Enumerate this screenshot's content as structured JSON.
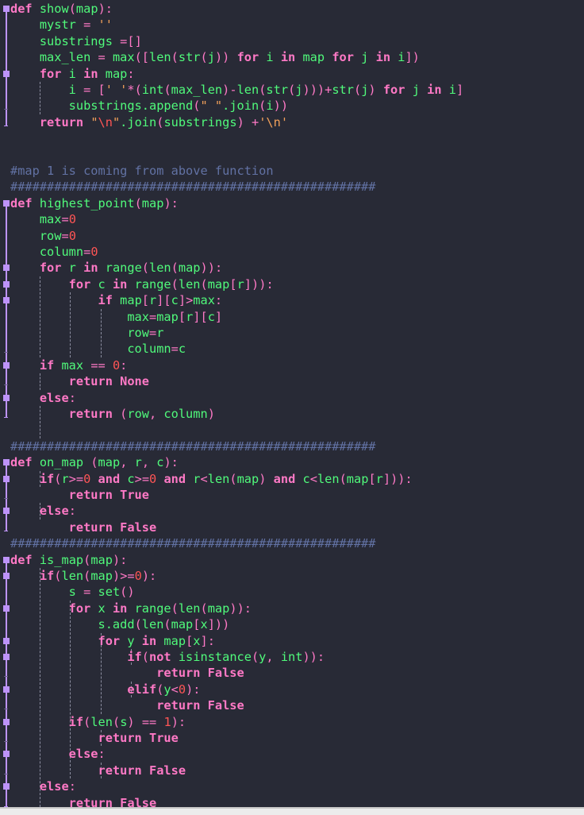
{
  "editor": {
    "theme_colors": {
      "background": "#282a36",
      "keyword": "#ff79c6",
      "identifier": "#50fa7b",
      "number": "#ff5555",
      "string": "#f1a05a",
      "comment": "#6272a4",
      "fold_marker": "#bd93f9"
    },
    "lines": [
      [
        [
          "kb",
          "def"
        ],
        [
          "g",
          " show"
        ],
        [
          "p",
          "("
        ],
        [
          "g",
          "map"
        ],
        [
          "p",
          "):"
        ]
      ],
      [
        [
          "g",
          "    mystr "
        ],
        [
          "p",
          "="
        ],
        [
          "s",
          " ''"
        ]
      ],
      [
        [
          "g",
          "    substrings "
        ],
        [
          "p",
          "=[]"
        ]
      ],
      [
        [
          "g",
          "    max_len "
        ],
        [
          "p",
          "="
        ],
        [
          "g",
          " max"
        ],
        [
          "p",
          "([",
          ""
        ],
        [
          "g",
          "len"
        ],
        [
          "p",
          "("
        ],
        [
          "g",
          "str"
        ],
        [
          "p",
          "("
        ],
        [
          "g",
          "j"
        ],
        [
          "p",
          "))"
        ],
        [
          "kb",
          " for"
        ],
        [
          "g",
          " i "
        ],
        [
          "kb",
          "in"
        ],
        [
          "g",
          " map "
        ],
        [
          "kb",
          "for"
        ],
        [
          "g",
          " j "
        ],
        [
          "kb",
          "in"
        ],
        [
          "g",
          " i"
        ],
        [
          "p",
          "])"
        ]
      ],
      [
        [
          "kb",
          "    for"
        ],
        [
          "g",
          " i "
        ],
        [
          "kb",
          "in"
        ],
        [
          "g",
          " map"
        ],
        [
          "p",
          ":"
        ]
      ],
      [
        [
          "g",
          "        i "
        ],
        [
          "p",
          "="
        ],
        [
          "p",
          " ["
        ],
        [
          "s",
          "' '"
        ],
        [
          "p",
          "*("
        ],
        [
          "g",
          "int"
        ],
        [
          "p",
          "("
        ],
        [
          "g",
          "max_len"
        ],
        [
          "p",
          ")-"
        ],
        [
          "g",
          "len"
        ],
        [
          "p",
          "("
        ],
        [
          "g",
          "str"
        ],
        [
          "p",
          "("
        ],
        [
          "g",
          "j"
        ],
        [
          "p",
          ")))+"
        ],
        [
          "g",
          "str"
        ],
        [
          "p",
          "("
        ],
        [
          "g",
          "j"
        ],
        [
          "p",
          ")"
        ],
        [
          "kb",
          " for"
        ],
        [
          "g",
          " j "
        ],
        [
          "kb",
          "in"
        ],
        [
          "g",
          " i"
        ],
        [
          "p",
          "]"
        ]
      ],
      [
        [
          "g",
          "        substrings.append"
        ],
        [
          "p",
          "("
        ],
        [
          "s",
          "\" \""
        ],
        [
          "g",
          ".join"
        ],
        [
          "p",
          "("
        ],
        [
          "g",
          "i"
        ],
        [
          "p",
          "))"
        ]
      ],
      [
        [
          "kb",
          "    return"
        ],
        [
          "s",
          " \""
        ],
        [
          "esc",
          "\\n"
        ],
        [
          "s",
          "\""
        ],
        [
          "g",
          ".join"
        ],
        [
          "p",
          "("
        ],
        [
          "g",
          "substrings"
        ],
        [
          "p",
          ")"
        ],
        [
          "p",
          " +"
        ],
        [
          "s",
          "'\\n'"
        ]
      ],
      [],
      [],
      [
        [
          "c",
          "#map 1 is coming from above function"
        ]
      ],
      [
        [
          "c",
          "##################################################"
        ]
      ],
      [
        [
          "kb",
          "def"
        ],
        [
          "g",
          " highest_point"
        ],
        [
          "p",
          "("
        ],
        [
          "g",
          "map"
        ],
        [
          "p",
          "):"
        ]
      ],
      [
        [
          "g",
          "    max"
        ],
        [
          "p",
          "="
        ],
        [
          "n",
          "0"
        ]
      ],
      [
        [
          "g",
          "    row"
        ],
        [
          "p",
          "="
        ],
        [
          "n",
          "0"
        ]
      ],
      [
        [
          "g",
          "    column"
        ],
        [
          "p",
          "="
        ],
        [
          "n",
          "0"
        ]
      ],
      [
        [
          "kb",
          "    for"
        ],
        [
          "g",
          " r "
        ],
        [
          "kb",
          "in"
        ],
        [
          "g",
          " range"
        ],
        [
          "p",
          "("
        ],
        [
          "g",
          "len"
        ],
        [
          "p",
          "("
        ],
        [
          "g",
          "map"
        ],
        [
          "p",
          "))"
        ],
        [
          "p",
          ":"
        ]
      ],
      [
        [
          "kb",
          "        for"
        ],
        [
          "g",
          " c "
        ],
        [
          "kb",
          "in"
        ],
        [
          "g",
          " range"
        ],
        [
          "p",
          "("
        ],
        [
          "g",
          "len"
        ],
        [
          "p",
          "("
        ],
        [
          "g",
          "map"
        ],
        [
          "p",
          "["
        ],
        [
          "g",
          "r"
        ],
        [
          "p",
          "]))"
        ],
        [
          "p",
          ":"
        ]
      ],
      [
        [
          "kb",
          "            if"
        ],
        [
          "g",
          " map"
        ],
        [
          "p",
          "["
        ],
        [
          "g",
          "r"
        ],
        [
          "p",
          "]["
        ],
        [
          "g",
          "c"
        ],
        [
          "p",
          "]>"
        ],
        [
          "g",
          "max"
        ],
        [
          "p",
          ":"
        ]
      ],
      [
        [
          "g",
          "                max"
        ],
        [
          "p",
          "="
        ],
        [
          "g",
          "map"
        ],
        [
          "p",
          "["
        ],
        [
          "g",
          "r"
        ],
        [
          "p",
          "]["
        ],
        [
          "g",
          "c"
        ],
        [
          "p",
          "]"
        ]
      ],
      [
        [
          "g",
          "                row"
        ],
        [
          "p",
          "="
        ],
        [
          "g",
          "r"
        ]
      ],
      [
        [
          "g",
          "                column"
        ],
        [
          "p",
          "="
        ],
        [
          "g",
          "c"
        ]
      ],
      [
        [
          "kb",
          "    if"
        ],
        [
          "g",
          " max "
        ],
        [
          "p",
          "=="
        ],
        [
          "n",
          " 0"
        ],
        [
          "p",
          ":"
        ]
      ],
      [
        [
          "kb",
          "        return None"
        ]
      ],
      [
        [
          "kb",
          "    else"
        ],
        [
          "p",
          ":"
        ]
      ],
      [
        [
          "kb",
          "        return"
        ],
        [
          "p",
          " ("
        ],
        [
          "g",
          "row"
        ],
        [
          "p",
          ","
        ],
        [
          "g",
          " column"
        ],
        [
          "p",
          ")"
        ]
      ],
      [],
      [
        [
          "c",
          "##################################################"
        ]
      ],
      [
        [
          "kb",
          "def"
        ],
        [
          "g",
          " on_map "
        ],
        [
          "p",
          "("
        ],
        [
          "g",
          "map"
        ],
        [
          "p",
          ","
        ],
        [
          "g",
          " r"
        ],
        [
          "p",
          ","
        ],
        [
          "g",
          " c"
        ],
        [
          "p",
          "):"
        ]
      ],
      [
        [
          "kb",
          "    if"
        ],
        [
          "p",
          "("
        ],
        [
          "g",
          "r"
        ],
        [
          "p",
          ">="
        ],
        [
          "n",
          "0"
        ],
        [
          "kb",
          " and"
        ],
        [
          "g",
          " c"
        ],
        [
          "p",
          ">="
        ],
        [
          "n",
          "0"
        ],
        [
          "kb",
          " and"
        ],
        [
          "g",
          " r"
        ],
        [
          "p",
          "<"
        ],
        [
          "g",
          "len"
        ],
        [
          "p",
          "("
        ],
        [
          "g",
          "map"
        ],
        [
          "p",
          ")"
        ],
        [
          "kb",
          " and"
        ],
        [
          "g",
          " c"
        ],
        [
          "p",
          "<"
        ],
        [
          "g",
          "len"
        ],
        [
          "p",
          "("
        ],
        [
          "g",
          "map"
        ],
        [
          "p",
          "["
        ],
        [
          "g",
          "r"
        ],
        [
          "p",
          "])):"
        ]
      ],
      [
        [
          "kb",
          "        return True"
        ]
      ],
      [
        [
          "kb",
          "    else"
        ],
        [
          "p",
          ":"
        ]
      ],
      [
        [
          "kb",
          "        return False"
        ]
      ],
      [
        [
          "c",
          "##################################################"
        ]
      ],
      [
        [
          "kb",
          "def"
        ],
        [
          "g",
          " is_map"
        ],
        [
          "p",
          "("
        ],
        [
          "g",
          "map"
        ],
        [
          "p",
          "):"
        ]
      ],
      [
        [
          "kb",
          "    if"
        ],
        [
          "p",
          "("
        ],
        [
          "g",
          "len"
        ],
        [
          "p",
          "("
        ],
        [
          "g",
          "map"
        ],
        [
          "p",
          ")>="
        ],
        [
          "n",
          "0"
        ],
        [
          "p",
          "):"
        ]
      ],
      [
        [
          "g",
          "        s "
        ],
        [
          "p",
          "="
        ],
        [
          "g",
          " set"
        ],
        [
          "p",
          "()"
        ]
      ],
      [
        [
          "kb",
          "        for"
        ],
        [
          "g",
          " x "
        ],
        [
          "kb",
          "in"
        ],
        [
          "g",
          " range"
        ],
        [
          "p",
          "("
        ],
        [
          "g",
          "len"
        ],
        [
          "p",
          "("
        ],
        [
          "g",
          "map"
        ],
        [
          "p",
          "))"
        ],
        [
          "p",
          ":"
        ]
      ],
      [
        [
          "g",
          "            s.add"
        ],
        [
          "p",
          "("
        ],
        [
          "g",
          "len"
        ],
        [
          "p",
          "("
        ],
        [
          "g",
          "map"
        ],
        [
          "p",
          "["
        ],
        [
          "g",
          "x"
        ],
        [
          "p",
          "]))"
        ]
      ],
      [
        [
          "kb",
          "            for"
        ],
        [
          "g",
          " y "
        ],
        [
          "kb",
          "in"
        ],
        [
          "g",
          " map"
        ],
        [
          "p",
          "["
        ],
        [
          "g",
          "x"
        ],
        [
          "p",
          "]:"
        ]
      ],
      [
        [
          "kb",
          "                if"
        ],
        [
          "p",
          "("
        ],
        [
          "kb",
          "not"
        ],
        [
          "g",
          " isinstance"
        ],
        [
          "p",
          "("
        ],
        [
          "g",
          "y"
        ],
        [
          "p",
          ","
        ],
        [
          "g",
          " int"
        ],
        [
          "p",
          "))"
        ],
        [
          "p",
          ":"
        ]
      ],
      [
        [
          "kb",
          "                    return False"
        ]
      ],
      [
        [
          "kb",
          "                elif"
        ],
        [
          "p",
          "("
        ],
        [
          "g",
          "y"
        ],
        [
          "p",
          "<"
        ],
        [
          "n",
          "0"
        ],
        [
          "p",
          "):"
        ]
      ],
      [
        [
          "kb",
          "                    return False"
        ]
      ],
      [
        [
          "kb",
          "        if"
        ],
        [
          "p",
          "("
        ],
        [
          "g",
          "len"
        ],
        [
          "p",
          "("
        ],
        [
          "g",
          "s"
        ],
        [
          "p",
          ")"
        ],
        [
          "p",
          " =="
        ],
        [
          "n",
          " 1"
        ],
        [
          "p",
          "):"
        ]
      ],
      [
        [
          "kb",
          "            return True"
        ]
      ],
      [
        [
          "kb",
          "        else"
        ],
        [
          "p",
          ":"
        ]
      ],
      [
        [
          "kb",
          "            return False"
        ]
      ],
      [
        [
          "kb",
          "    else"
        ],
        [
          "p",
          ":"
        ]
      ],
      [
        [
          "kb",
          "        return False"
        ]
      ]
    ]
  }
}
